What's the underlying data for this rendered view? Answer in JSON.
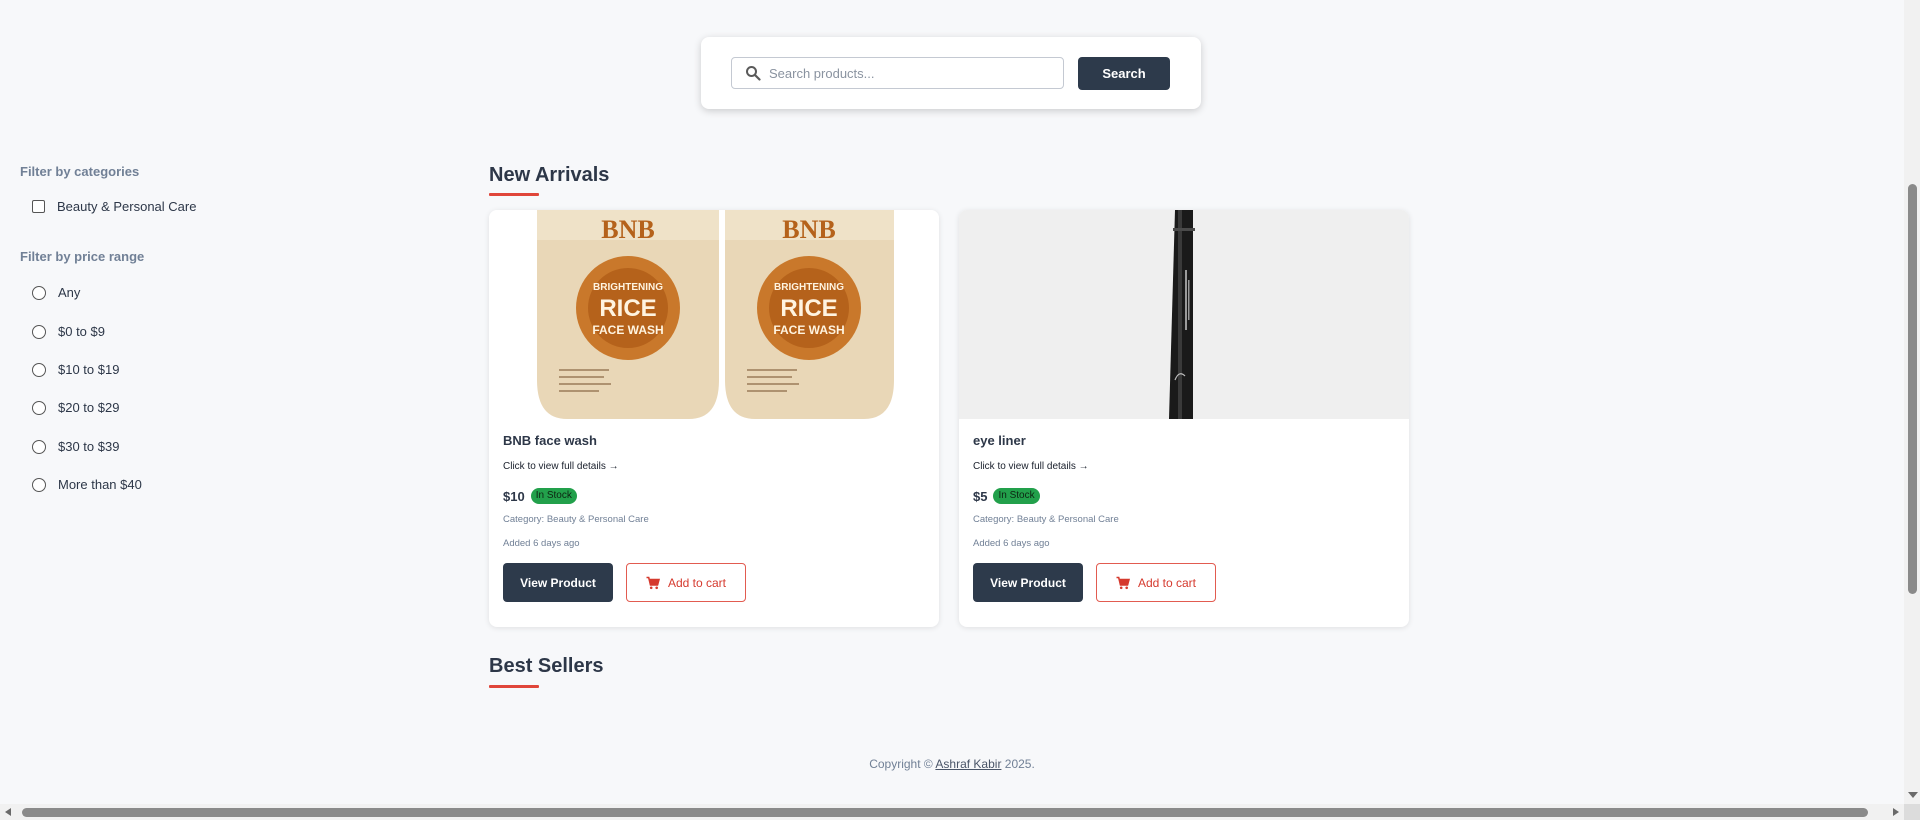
{
  "search": {
    "placeholder": "Search products...",
    "button_label": "Search",
    "icon": "search-icon"
  },
  "filters": {
    "categories_heading": "Filter by categories",
    "categories": [
      {
        "label": "Beauty & Personal Care",
        "checked": false
      }
    ],
    "price_heading": "Filter by price range",
    "price_ranges": [
      {
        "label": "Any",
        "selected": false
      },
      {
        "label": "$0 to $9",
        "selected": false
      },
      {
        "label": "$10 to $19",
        "selected": false
      },
      {
        "label": "$20 to $29",
        "selected": false
      },
      {
        "label": "$30 to $39",
        "selected": false
      },
      {
        "label": "More than $40",
        "selected": false
      }
    ]
  },
  "sections": {
    "new_arrivals": "New Arrivals",
    "best_sellers": "Best Sellers"
  },
  "products": [
    {
      "name": "BNB face wash",
      "details_link": "Click to view full details →",
      "price": "$10",
      "stock_badge": "In Stock",
      "category": "Category: Beauty & Personal Care",
      "added": "Added 6 days ago",
      "view_label": "View Product",
      "cart_label": "Add to cart",
      "image_brand_text": "BNB",
      "image_text_1": "BRIGHTENING",
      "image_text_2": "RICE",
      "image_text_3": "FACE WASH"
    },
    {
      "name": "eye liner",
      "details_link": "Click to view full details →",
      "price": "$5",
      "stock_badge": "In Stock",
      "category": "Category: Beauty & Personal Care",
      "added": "Added 6 days ago",
      "view_label": "View Product",
      "cart_label": "Add to cart"
    }
  ],
  "footer": {
    "prefix": "Copyright ©",
    "author": "Ashraf Kabir",
    "year": "2025."
  },
  "colors": {
    "accent": "#e0463a",
    "primary_button": "#2d3a4b",
    "in_stock": "#22a04b",
    "background": "#f7f8fa"
  }
}
